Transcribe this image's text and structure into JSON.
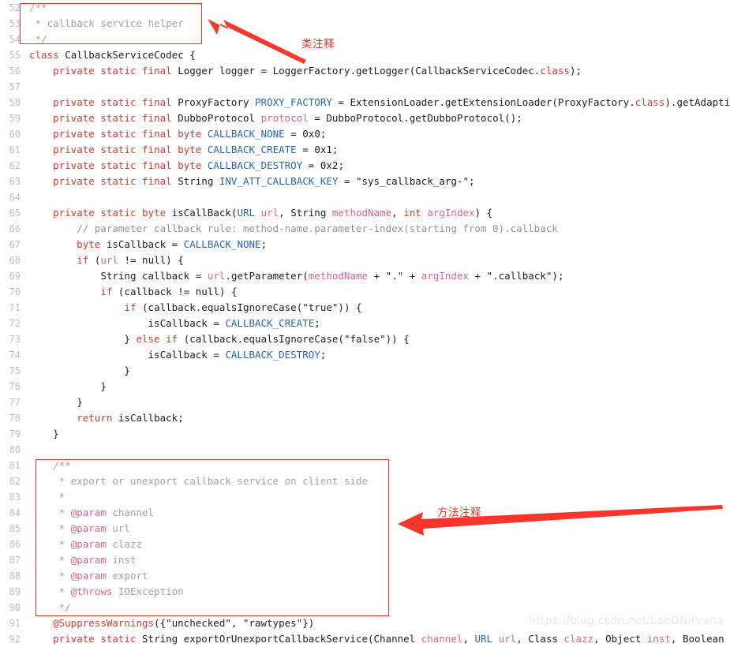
{
  "editor": {
    "language": "java",
    "first_line_number": 52,
    "last_line_number": 92,
    "lines": [
      {
        "n": "52",
        "text": "/**"
      },
      {
        "n": "53",
        "text": " * callback service helper"
      },
      {
        "n": "54",
        "text": " */"
      },
      {
        "n": "55",
        "text": "class CallbackServiceCodec {"
      },
      {
        "n": "56",
        "text": "    private static final Logger logger = LoggerFactory.getLogger(CallbackServiceCodec.class);"
      },
      {
        "n": "57",
        "text": ""
      },
      {
        "n": "58",
        "text": "    private static final ProxyFactory PROXY_FACTORY = ExtensionLoader.getExtensionLoader(ProxyFactory.class).getAdaptiveExtension();"
      },
      {
        "n": "59",
        "text": "    private static final DubboProtocol protocol = DubboProtocol.getDubboProtocol();"
      },
      {
        "n": "60",
        "text": "    private static final byte CALLBACK_NONE = 0x0;"
      },
      {
        "n": "61",
        "text": "    private static final byte CALLBACK_CREATE = 0x1;"
      },
      {
        "n": "62",
        "text": "    private static final byte CALLBACK_DESTROY = 0x2;"
      },
      {
        "n": "63",
        "text": "    private static final String INV_ATT_CALLBACK_KEY = \"sys_callback_arg-\";"
      },
      {
        "n": "64",
        "text": ""
      },
      {
        "n": "65",
        "text": "    private static byte isCallBack(URL url, String methodName, int argIndex) {"
      },
      {
        "n": "66",
        "text": "        // parameter callback rule: method-name.parameter-index(starting from 0).callback"
      },
      {
        "n": "67",
        "text": "        byte isCallback = CALLBACK_NONE;"
      },
      {
        "n": "68",
        "text": "        if (url != null) {"
      },
      {
        "n": "69",
        "text": "            String callback = url.getParameter(methodName + \".\" + argIndex + \".callback\");"
      },
      {
        "n": "70",
        "text": "            if (callback != null) {"
      },
      {
        "n": "71",
        "text": "                if (callback.equalsIgnoreCase(\"true\")) {"
      },
      {
        "n": "72",
        "text": "                    isCallback = CALLBACK_CREATE;"
      },
      {
        "n": "73",
        "text": "                } else if (callback.equalsIgnoreCase(\"false\")) {"
      },
      {
        "n": "74",
        "text": "                    isCallback = CALLBACK_DESTROY;"
      },
      {
        "n": "75",
        "text": "                }"
      },
      {
        "n": "76",
        "text": "            }"
      },
      {
        "n": "77",
        "text": "        }"
      },
      {
        "n": "78",
        "text": "        return isCallback;"
      },
      {
        "n": "79",
        "text": "    }"
      },
      {
        "n": "80",
        "text": ""
      },
      {
        "n": "81",
        "text": "    /**"
      },
      {
        "n": "82",
        "text": "     * export or unexport callback service on client side"
      },
      {
        "n": "83",
        "text": "     *"
      },
      {
        "n": "84",
        "text": "     * @param channel"
      },
      {
        "n": "85",
        "text": "     * @param url"
      },
      {
        "n": "86",
        "text": "     * @param clazz"
      },
      {
        "n": "87",
        "text": "     * @param inst"
      },
      {
        "n": "88",
        "text": "     * @param export"
      },
      {
        "n": "89",
        "text": "     * @throws IOException"
      },
      {
        "n": "90",
        "text": "     */"
      },
      {
        "n": "91",
        "text": "    @SuppressWarnings({\"unchecked\", \"rawtypes\"})"
      },
      {
        "n": "92",
        "text": "    private static String exportOrUnexportCallbackService(Channel channel, URL url, Class clazz, Object inst, Boolean export) throws IO"
      }
    ]
  },
  "annotations": {
    "class_comment": {
      "label": "类注释",
      "arrow": "red-arrow-up-left",
      "box": "class-javadoc-highlight"
    },
    "method_comment": {
      "label": "方法注释",
      "arrow": "red-arrow-left",
      "box": "method-javadoc-highlight"
    }
  },
  "watermark": {
    "text": "https://blog.csdn.net/LabDNirvana"
  },
  "colors": {
    "annotation_red": "#ee3124",
    "keyword_red": "#d83931",
    "constant_blue": "#2a64b8",
    "param_pink": "#d2649a",
    "comment_gray": "#9aa4b0",
    "gutter_gray": "#b8bfc9",
    "watermark_gray": "#e9e9e9"
  }
}
